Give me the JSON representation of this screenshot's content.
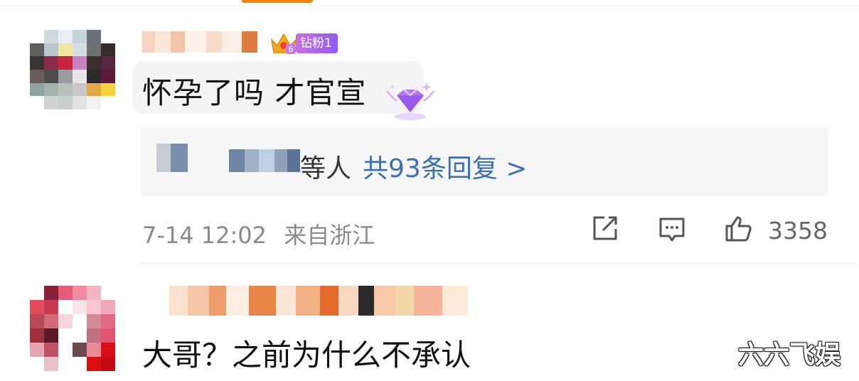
{
  "comments": [
    {
      "badge": {
        "level": "6",
        "label": "钻粉1"
      },
      "text": "怀孕了吗 才官宣",
      "replies": {
        "who_suffix": "等人",
        "count_text": "共93条回复 >"
      },
      "meta": {
        "date": "7-14 12:02",
        "location": "来自浙江"
      },
      "likes": "3358",
      "icons": [
        "share-icon",
        "comment-icon",
        "like-icon"
      ]
    },
    {
      "text": "大哥？之前为什么不承认"
    }
  ],
  "watermark": "六六飞娱",
  "colors": {
    "accent_orange": "#ff8200",
    "link_blue": "#3a6fb2",
    "badge_purple": "#a865ea",
    "meta_gray": "#8a8a8a"
  }
}
